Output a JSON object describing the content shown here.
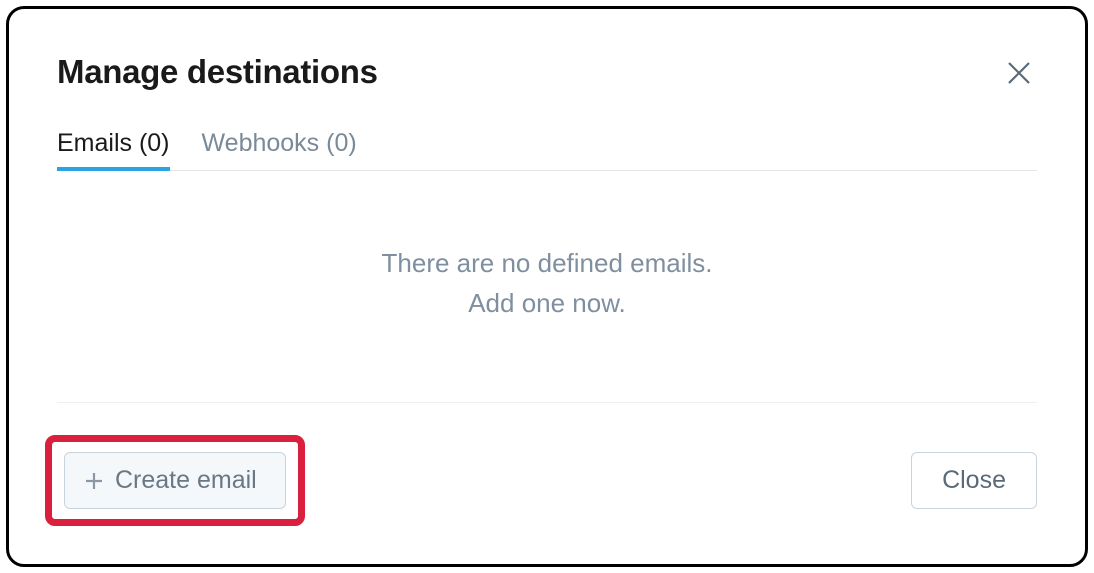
{
  "dialog": {
    "title": "Manage destinations"
  },
  "tabs": {
    "emails": {
      "label": "Emails (0)"
    },
    "webhooks": {
      "label": "Webhooks (0)"
    }
  },
  "emptyState": {
    "line1": "There are no defined emails.",
    "line2": "Add one now."
  },
  "footer": {
    "createLabel": "Create email",
    "closeLabel": "Close"
  }
}
